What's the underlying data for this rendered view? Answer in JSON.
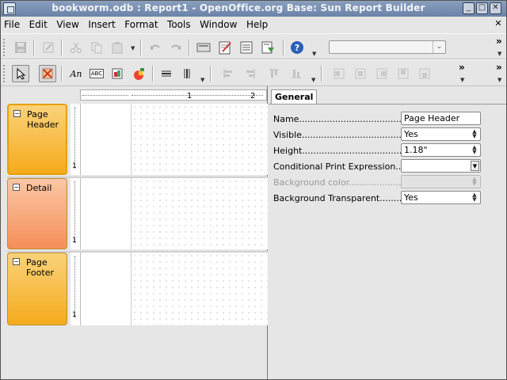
{
  "window": {
    "title": "bookworm.odb : Report1 - OpenOffice.org Base: Sun Report Builder",
    "buttons": {
      "minimize": "_",
      "maximize": "□",
      "close": "✕"
    }
  },
  "menu": {
    "items": [
      "File",
      "Edit",
      "View",
      "Insert",
      "Format",
      "Tools",
      "Window",
      "Help"
    ],
    "close_document": "✕"
  },
  "toolbar2": {
    "label_field_text": "An",
    "text_box_text": "ABC"
  },
  "more_glyph": "»",
  "ruler": {
    "marks": [
      "1",
      "2"
    ]
  },
  "sections": [
    {
      "name_line1": "Page",
      "name_line2": "Header",
      "color": "#f7b82f"
    },
    {
      "name_line1": "Detail",
      "name_line2": "",
      "color": "#f59b6b"
    },
    {
      "name_line1": "Page",
      "name_line2": "Footer",
      "color": "#f7b82f"
    }
  ],
  "vertical_ruler_mark": "1",
  "properties": {
    "tab": "General",
    "rows": [
      {
        "label": "Name......................................",
        "value": "Page Header",
        "enabled": true
      },
      {
        "label": "Visible............................................",
        "value": "Yes",
        "enabled": true
      },
      {
        "label": "Height...............................................",
        "value": "1.18\"",
        "enabled": true
      },
      {
        "label": "Conditional Print Expression....",
        "value": "",
        "enabled": true
      },
      {
        "label": "Background color.......................",
        "value": "",
        "enabled": false
      },
      {
        "label": "Background Transparent...........",
        "value": "Yes",
        "enabled": true
      }
    ]
  },
  "colors": {
    "titlebar": "#7489ad",
    "section_header": "#f7b82f",
    "section_detail": "#f59b6b",
    "help_blue": "#2a5fb8"
  }
}
